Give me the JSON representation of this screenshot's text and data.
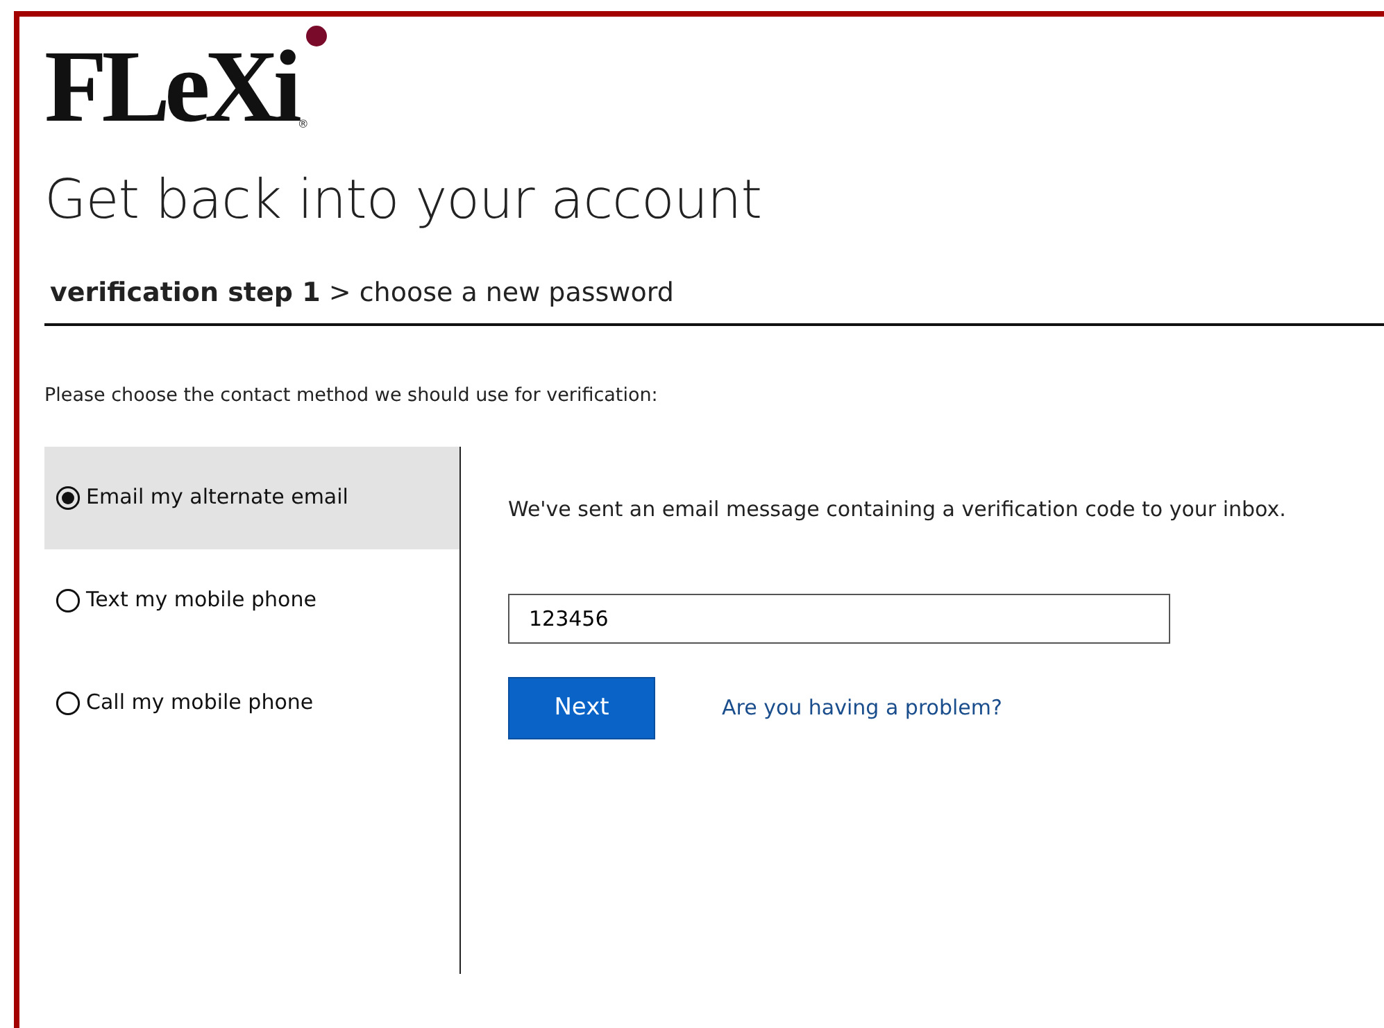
{
  "logo": {
    "text": "FLeXi",
    "registered_mark": "®"
  },
  "title": "Get back into your account",
  "steps": "**verification step 1** > choose a new password",
  "prompt": "Please choose the contact method we should use for verification:",
  "methods": [
    {
      "label": "Email my alternate email",
      "selected": true
    },
    {
      "label": "Text my mobile phone",
      "selected": false
    },
    {
      "label": "Call my mobile phone",
      "selected": false
    }
  ],
  "message": "We've sent an email message containing a verification code to your inbox.",
  "code_field": {
    "value": "123456"
  },
  "next_button": "Next",
  "help_link": "Are you having a problem?"
}
